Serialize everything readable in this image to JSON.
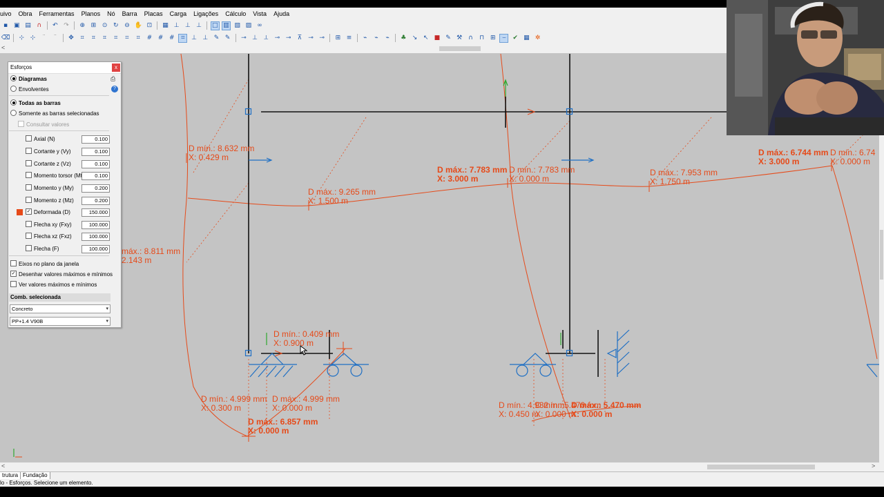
{
  "menu": [
    "uivo",
    "Obra",
    "Ferramentas",
    "Planos",
    "Nó",
    "Barra",
    "Placas",
    "Carga",
    "Ligações",
    "Cálculo",
    "Vista",
    "Ajuda"
  ],
  "toolbar_icons": [
    "save-icon",
    "open-icon",
    "print-icon",
    "magnet-icon",
    "undo-icon",
    "redo-icon",
    "zoom-icon",
    "pan-icon",
    "view-icon",
    "select-icon"
  ],
  "panel": {
    "title": "Esforços",
    "close": "x",
    "radio_diagramas": "Diagramas",
    "radio_envolventes": "Envolventes",
    "radio_todas": "Todas as barras",
    "radio_selecionadas": "Somente as barras selecionadas",
    "check_consultar": "Consultar valores",
    "items": [
      {
        "label": "Axial (N)",
        "value": "0.100",
        "checked": false
      },
      {
        "label": "Cortante y (Vy)",
        "value": "0.100",
        "checked": false
      },
      {
        "label": "Cortante z (Vz)",
        "value": "0.100",
        "checked": false
      },
      {
        "label": "Momento torsor (Mt)",
        "value": "0.100",
        "checked": false
      },
      {
        "label": "Momento y (My)",
        "value": "0.200",
        "checked": false
      },
      {
        "label": "Momento z (Mz)",
        "value": "0.200",
        "checked": false
      },
      {
        "label": "Deformada (D)",
        "value": "150.000",
        "checked": true
      },
      {
        "label": "Flecha xy (Fxy)",
        "value": "100.000",
        "checked": false
      },
      {
        "label": "Flecha xz (Fxz)",
        "value": "100.000",
        "checked": false
      },
      {
        "label": "Flecha (F)",
        "value": "100.000",
        "checked": false
      }
    ],
    "opt_eixos": "Eixos no plano da janela",
    "opt_desenhar": "Desenhar valores máximos e mínimos",
    "opt_ver": "Ver valores máximos e mínimos",
    "comb_header": "Comb. selecionada",
    "select_material": "Concreto",
    "select_comb": "PP+1.4 V90B"
  },
  "canvas_labels": [
    {
      "t1": "D mín.: 8.632 mm",
      "t2": "X: 0.429 m"
    },
    {
      "t1": "D máx.: 9.265 mm",
      "t2": "X: 1.500 m"
    },
    {
      "t1": "D máx.: 7.783 mm",
      "t2": "X: 3.000 m"
    },
    {
      "t1": "D mín.: 7.783 mm",
      "t2": "X: 0.000 m"
    },
    {
      "t1": "D máx.: 7.953 mm",
      "t2": "X: 1.750 m"
    },
    {
      "t1": "D máx.: 6.744 mm",
      "t2": "X: 3.000 m"
    },
    {
      "t1": "D mín.: 6.74",
      "t2": "X: 0.000 m"
    },
    {
      "t1": "máx.: 8.811 mm",
      "t2": "2.143 m"
    },
    {
      "t1": "D mín.: 0.409 mm",
      "t2": "X: 0.900 m"
    },
    {
      "t1": "D mín.: 4.999 mm",
      "t2": "X: 0.300 m"
    },
    {
      "t1": "D máx.: 4.999 mm",
      "t2": "X: 0.000 m"
    },
    {
      "t1": "D máx.: 6.857 mm",
      "t2": "X: 0.000 m"
    },
    {
      "t1": "D mín.: 4.932 mm",
      "t2": "X: 0.450 m"
    },
    {
      "t1": "D mín.: 5.470 mm",
      "t2": "X: 0.000 m"
    },
    {
      "t1": "D máx.: 5.470 mm",
      "t2": "X: 0.000 m"
    }
  ],
  "tabs": [
    "trutura",
    "Fundação"
  ],
  "status": "lo - Esforços. Selecione um elemento.",
  "colors": {
    "diagram": "#e64a19",
    "structure": "#111111",
    "support": "#1e6fc4",
    "canvas": "#c4c4c4"
  }
}
